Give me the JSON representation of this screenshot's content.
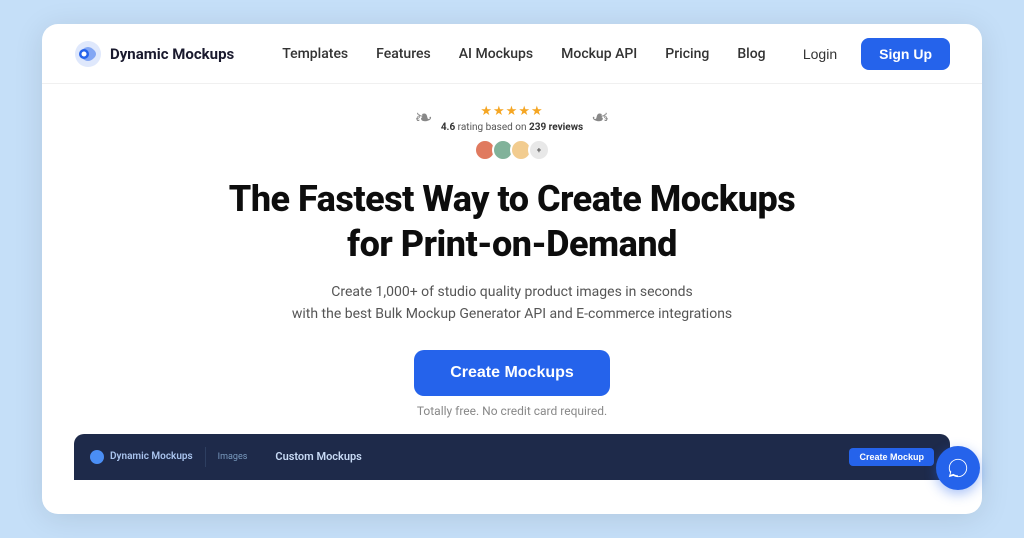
{
  "brand": {
    "logo_text": "Dynamic Mockups",
    "logo_color": "#2563eb"
  },
  "navbar": {
    "links": [
      {
        "label": "Templates",
        "id": "templates"
      },
      {
        "label": "Features",
        "id": "features"
      },
      {
        "label": "AI Mockups",
        "id": "ai-mockups"
      },
      {
        "label": "Mockup API",
        "id": "mockup-api"
      },
      {
        "label": "Pricing",
        "id": "pricing"
      },
      {
        "label": "Blog",
        "id": "blog"
      }
    ],
    "login_label": "Login",
    "signup_label": "Sign Up"
  },
  "hero": {
    "rating_score": "4.6",
    "rating_text": "4.6 rating based on 239 reviews",
    "stars": "★★★★★",
    "heading_line1": "The Fastest Way to Create Mockups",
    "heading_line2": "for Print-on-Demand",
    "subtext_line1": "Create 1,000+ of studio quality product images in seconds",
    "subtext_line2": "with the best Bulk Mockup Generator API and E-commerce integrations",
    "cta_label": "Create Mockups",
    "cta_note": "Totally free. No credit card required."
  },
  "preview_bar": {
    "logo_text": "Dynamic Mockups",
    "nav_item": "Images",
    "title": "Custom Mockups",
    "button_label": "Create Mockup"
  },
  "chat": {
    "icon": "chat-icon"
  }
}
